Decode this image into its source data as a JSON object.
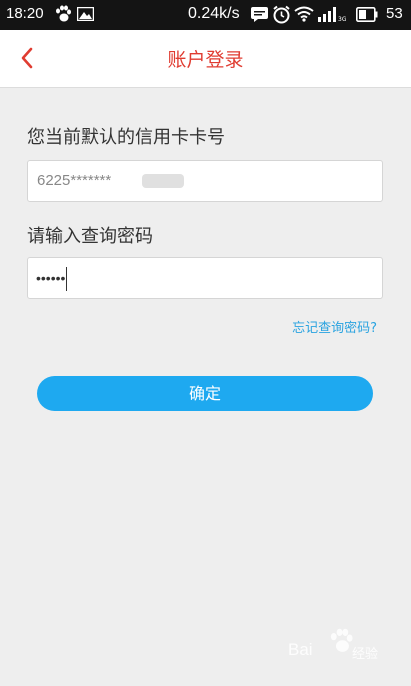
{
  "status_bar": {
    "time": "18:20",
    "network_speed": "0.24k/s",
    "battery_level": "53",
    "icons": [
      "paw-icon",
      "image-icon",
      "message-icon",
      "alarm-icon",
      "wifi-icon",
      "signal-icon",
      "battery-icon"
    ]
  },
  "nav": {
    "title": "账户登录",
    "back_icon": "chevron-left-icon",
    "accent_color": "#e03c31"
  },
  "form": {
    "card_label": "您当前默认的信用卡卡号",
    "card_value": "6225*******",
    "password_label": "请输入查询密码",
    "password_value": "••••••",
    "forgot_link": "忘记查询密码?",
    "confirm_label": "确定",
    "button_color": "#1ea9f0",
    "link_color": "#2aa3e0"
  },
  "watermark": {
    "brand_left": "Bai",
    "brand_right": "经验"
  }
}
